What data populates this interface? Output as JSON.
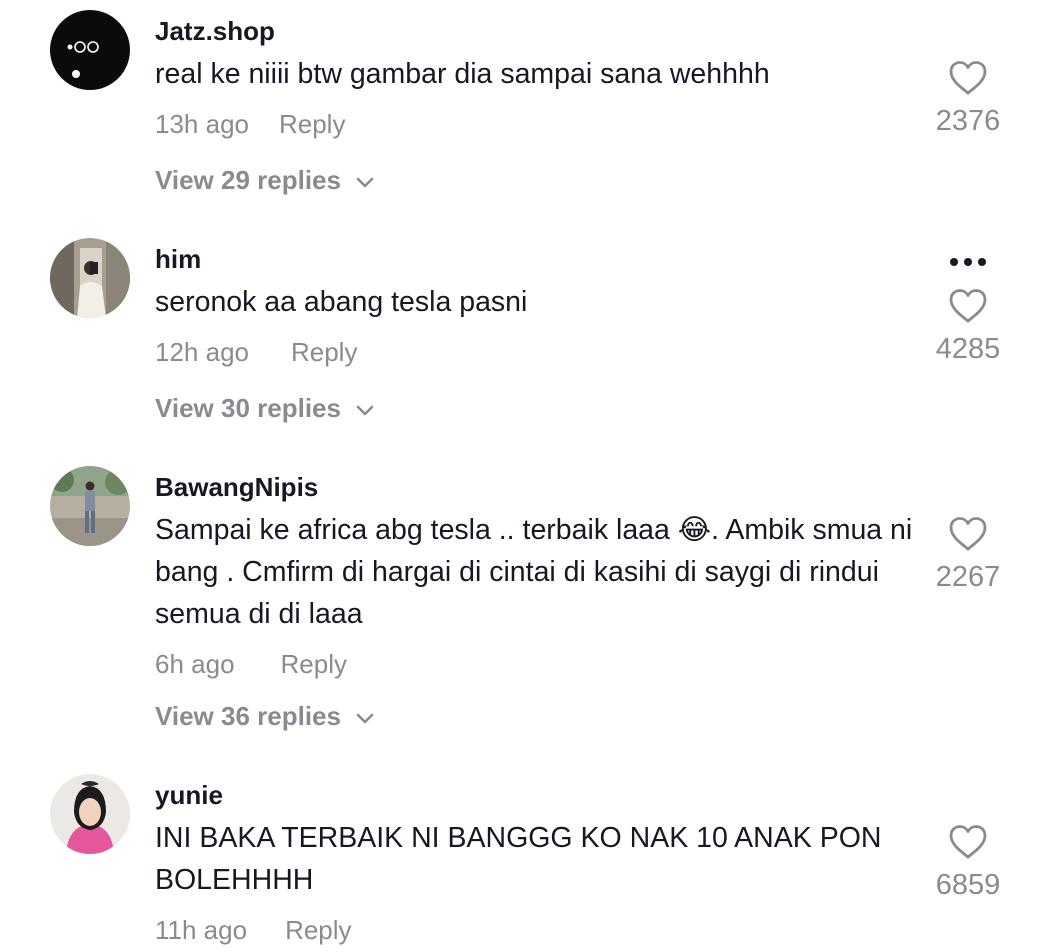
{
  "comments": [
    {
      "username": "Jatz.shop",
      "text": "real ke niiii btw gambar dia sampai sana wehhhh",
      "time": "13h ago",
      "reply_label": "Reply",
      "replies_label": "View 29 replies",
      "likes": "2376",
      "avatar": "dark-logo-avatar"
    },
    {
      "username": "him",
      "text": "seronok aa abang tesla pasni",
      "time": "12h ago",
      "reply_label": "Reply",
      "replies_label": "View 30 replies",
      "likes": "4285",
      "avatar": "mirror-selfie-avatar",
      "more_icon": "more-horizontal-icon"
    },
    {
      "username": "BawangNipis",
      "text": "Sampai ke africa abg tesla .. terbaik laaa 😂. Ambik smua ni bang . Cmfirm di hargai di cintai di kasihi di saygi di rindui semua di di laaa",
      "time": "6h ago",
      "reply_label": "Reply",
      "replies_label": "View 36 replies",
      "likes": "2267",
      "avatar": "outdoor-person-avatar"
    },
    {
      "username": "yunie",
      "text": "INI BAKA TERBAIK NI BANGGG KO NAK 10 ANAK PON BOLEHHHH",
      "time": "11h ago",
      "reply_label": "Reply",
      "likes": "6859",
      "avatar": "hijab-portrait-avatar"
    }
  ],
  "colors": {
    "primary_text": "#161823",
    "secondary_text": "#8a8b91",
    "background": "#ffffff"
  },
  "icons": {
    "like": "heart-outline-icon",
    "expand": "chevron-down-icon"
  }
}
